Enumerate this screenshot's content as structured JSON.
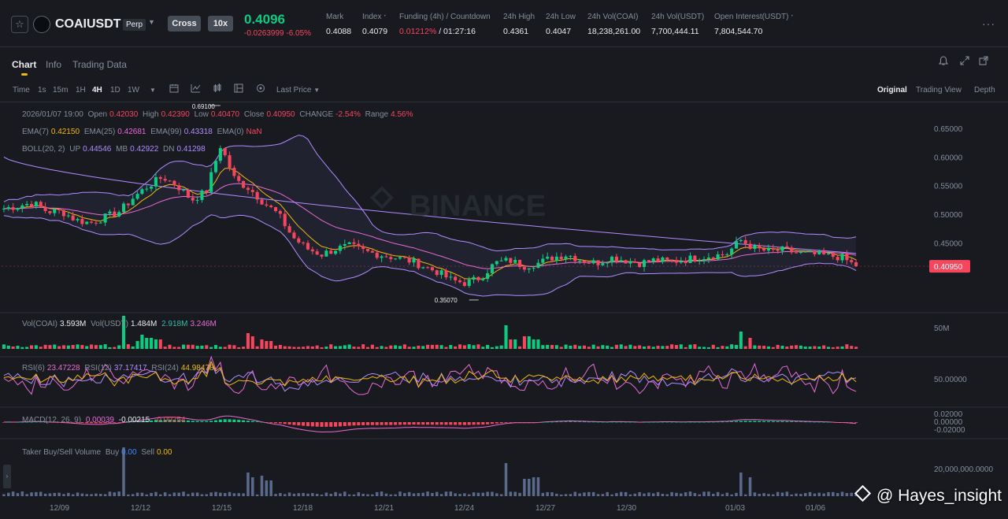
{
  "ticker": {
    "star_icon": "star-icon",
    "symbol": "COAIUSDT",
    "contract_type": "Perp",
    "margin_mode": "Cross",
    "leverage": "10x",
    "last_price": "0.4096",
    "change_abs": "-0.0263999",
    "change_pct": "-6.05%",
    "stats": [
      {
        "label": "Mark",
        "value": "0.4088"
      },
      {
        "label": "Index",
        "value": "0.4079"
      },
      {
        "label": "Funding (4h) / Countdown",
        "value": "0.01212%",
        "value2": "/ 01:27:16"
      },
      {
        "label": "24h High",
        "value": "0.4361"
      },
      {
        "label": "24h Low",
        "value": "0.4047"
      },
      {
        "label": "24h Vol(COAI)",
        "value": "18,238,261.00"
      },
      {
        "label": "24h Vol(USDT)",
        "value": "7,700,444.11"
      },
      {
        "label": "Open Interest(USDT)",
        "value": "7,804,544.70"
      }
    ]
  },
  "tabs": [
    "Chart",
    "Info",
    "Trading Data"
  ],
  "toolbar": {
    "intervals": [
      "Time",
      "1s",
      "15m",
      "1H",
      "4H",
      "1D",
      "1W"
    ],
    "active_interval": "4H",
    "price_type": "Last Price",
    "views": [
      "Original",
      "Trading View",
      "Depth"
    ],
    "active_view": "Original"
  },
  "legend": {
    "ohlc": {
      "datetime": "2026/01/07 19:00",
      "open_label": "Open",
      "open": "0.42030",
      "high_label": "High",
      "high": "0.42390",
      "low_label": "Low",
      "low": "0.40470",
      "close_label": "Close",
      "close": "0.40950",
      "change_label": "CHANGE",
      "change": "-2.54%",
      "range_label": "Range",
      "range": "4.56%"
    },
    "ema": {
      "ema7_label": "EMA(7)",
      "ema7": "0.42150",
      "ema25_label": "EMA(25)",
      "ema25": "0.42681",
      "ema99_label": "EMA(99)",
      "ema99": "0.43318",
      "ema0_label": "EMA(0)",
      "ema0": "NaN"
    },
    "boll": {
      "label": "BOLL(20, 2)",
      "up_label": "UP",
      "up": "0.44546",
      "mb_label": "MB",
      "mb": "0.42922",
      "dn_label": "DN",
      "dn": "0.41298"
    },
    "vol": {
      "coai_label": "Vol(COAI)",
      "coai": "3.593M",
      "usdt_label": "Vol(USDT)",
      "usdt": "1.484M",
      "ma1": "2.918M",
      "ma2": "3.246M"
    },
    "rsi": {
      "rsi6_label": "RSI(6)",
      "rsi6": "23.47228",
      "rsi12_label": "RSI(12)",
      "rsi12": "37.17417",
      "rsi24_label": "RSI(24)",
      "rsi24": "44.98478"
    },
    "macd": {
      "label": "MACD(12, 26, 9)",
      "v1": "0.00039",
      "v2": "-0.00215",
      "v3": "-0.00254"
    },
    "taker": {
      "label": "Taker Buy/Sell Volume",
      "buy_label": "Buy",
      "buy": "0.00",
      "sell_label": "Sell",
      "sell": "0.00"
    }
  },
  "axes": {
    "price_ticks": [
      "0.65000",
      "0.60000",
      "0.55000",
      "0.50000",
      "0.45000"
    ],
    "current_price_tag": "0.40950",
    "vol_tick": "50M",
    "rsi_tick": "50.00000",
    "macd_ticks": [
      "0.02000",
      "0.00000",
      "-0.02000"
    ],
    "taker_tick": "20,000,000.0000",
    "date_ticks": [
      "12/09",
      "12/12",
      "12/15",
      "12/18",
      "12/21",
      "12/24",
      "12/27",
      "12/30",
      "01/03",
      "01/06"
    ],
    "high_marker": "0.69100",
    "low_marker": "0.35070",
    "watermark_brand": "BINANCE"
  },
  "chart_data": {
    "type": "candlestick",
    "interval": "4H",
    "y_range": [
      0.33,
      0.68
    ],
    "x_range": [
      "12/07",
      "01/07"
    ],
    "dates": [
      "12/09",
      "12/12",
      "12/15",
      "12/18",
      "12/21",
      "12/24",
      "12/27",
      "12/30",
      "01/03",
      "01/06"
    ],
    "close_path": [
      0.51,
      0.515,
      0.52,
      0.505,
      0.505,
      0.49,
      0.485,
      0.495,
      0.505,
      0.53,
      0.55,
      0.565,
      0.55,
      0.525,
      0.54,
      0.62,
      0.56,
      0.545,
      0.52,
      0.5,
      0.46,
      0.44,
      0.43,
      0.44,
      0.445,
      0.435,
      0.43,
      0.425,
      0.42,
      0.41,
      0.4,
      0.385,
      0.38,
      0.39,
      0.415,
      0.42,
      0.41,
      0.415,
      0.425,
      0.43,
      0.42,
      0.415,
      0.425,
      0.42,
      0.415,
      0.42,
      0.418,
      0.42,
      0.425,
      0.428,
      0.43,
      0.455,
      0.44,
      0.435,
      0.438,
      0.432,
      0.43,
      0.428,
      0.425,
      0.4095
    ],
    "period_high": 0.691,
    "period_low": 0.3507,
    "last_close": 0.4095
  },
  "watermark_text": "@ Hayes_insight"
}
